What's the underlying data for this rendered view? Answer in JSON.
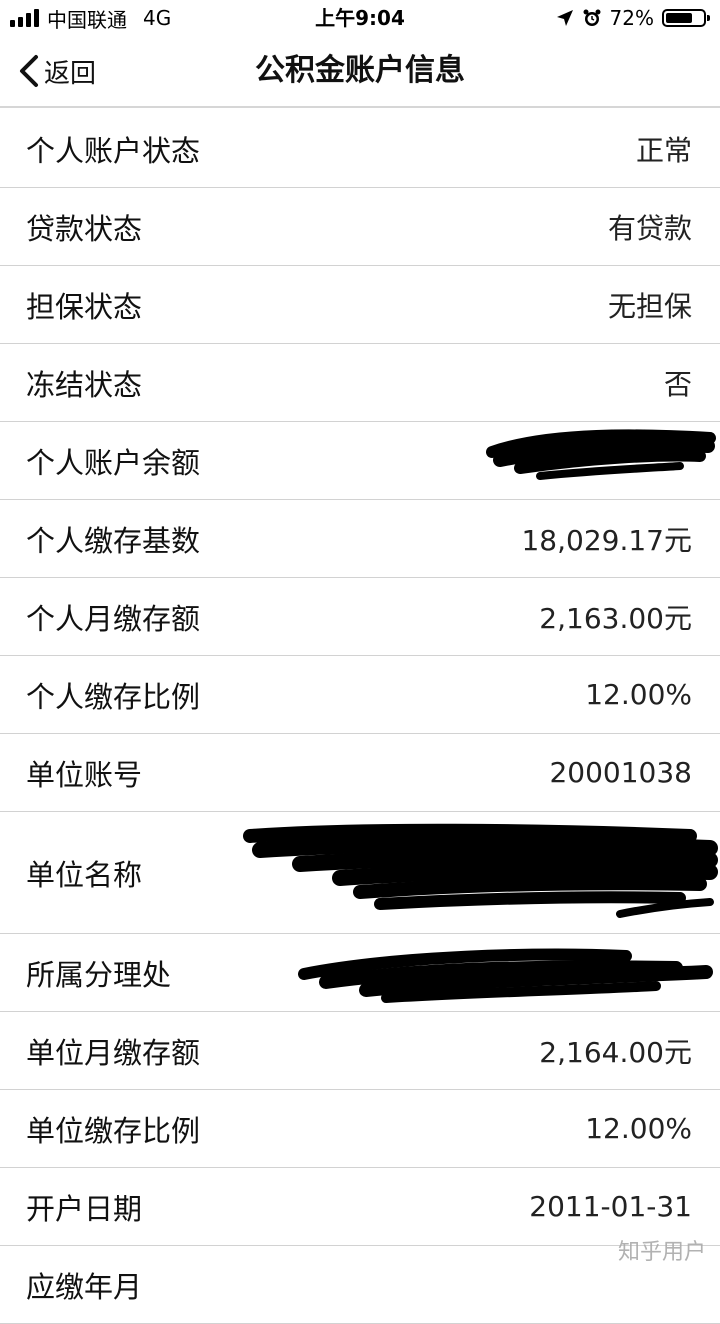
{
  "status_bar": {
    "carrier": "中国联通",
    "network": "4G",
    "time": "上午9:04",
    "battery": "72%",
    "battery_level": 0.72,
    "icons": [
      "signal-icon",
      "location-arrow-icon",
      "alarm-icon",
      "battery-icon"
    ]
  },
  "nav": {
    "back_label": "返回",
    "title": "公积金账户信息"
  },
  "rows": [
    {
      "label": "个人账户状态",
      "value": "正常"
    },
    {
      "label": "贷款状态",
      "value": "有贷款"
    },
    {
      "label": "担保状态",
      "value": "无担保"
    },
    {
      "label": "冻结状态",
      "value": "否"
    },
    {
      "label": "个人账户余额",
      "value": ""
    },
    {
      "label": "个人缴存基数",
      "value": "18,029.17元"
    },
    {
      "label": "个人月缴存额",
      "value": "2,163.00元"
    },
    {
      "label": "个人缴存比例",
      "value": "12.00%"
    },
    {
      "label": "单位账号",
      "value": "20001038"
    },
    {
      "label": "单位名称",
      "value": ""
    },
    {
      "label": "所属分理处",
      "value": ""
    },
    {
      "label": "单位月缴存额",
      "value": "2,164.00元"
    },
    {
      "label": "单位缴存比例",
      "value": "12.00%"
    },
    {
      "label": "开户日期",
      "value": "2011-01-31"
    },
    {
      "label": "应缴年月",
      "value": ""
    }
  ],
  "watermark": "知乎用户",
  "colors": {
    "redaction": "#000000",
    "divider": "#d2d2d2",
    "background": "#ffffff"
  }
}
